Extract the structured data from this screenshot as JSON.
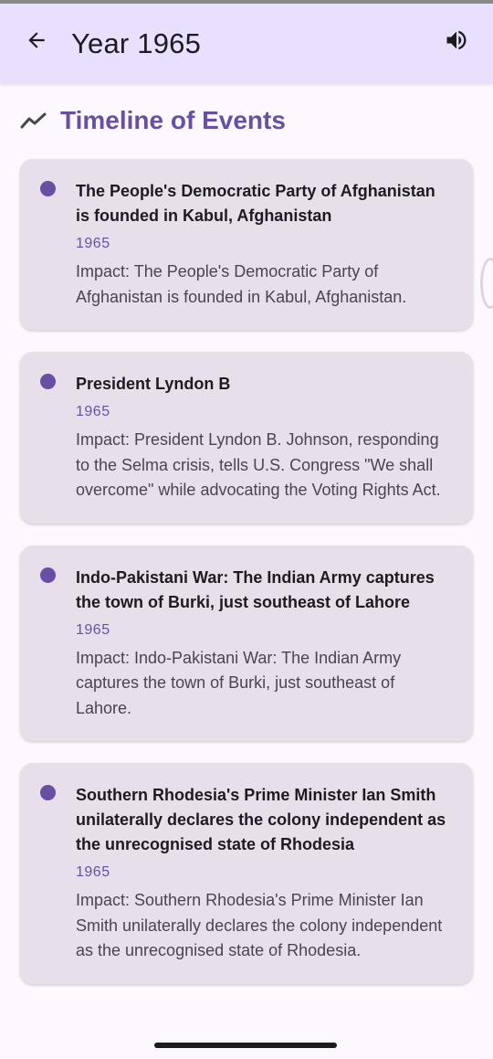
{
  "appbar": {
    "title": "Year 1965",
    "back_icon": "arrow-back-icon",
    "sound_icon": "volume-up-icon",
    "background": "#e8e0fd"
  },
  "section": {
    "title": "Timeline of Events",
    "icon": "trending-icon",
    "accent": "#6750a4"
  },
  "events": [
    {
      "title": "The People's Democratic Party of Afghanistan is founded in Kabul, Afghanistan",
      "year": "1965",
      "impact": "Impact: The People's Democratic Party of Afghanistan is founded in Kabul, Afghanistan."
    },
    {
      "title": "President Lyndon B",
      "year": "1965",
      "impact": "Impact: President Lyndon B. Johnson, responding to the Selma crisis, tells U.S. Congress \"We shall overcome\" while advocating the Voting Rights Act."
    },
    {
      "title": "Indo-Pakistani War: The Indian Army captures the town of Burki, just southeast of Lahore",
      "year": "1965",
      "impact": "Impact: Indo-Pakistani War: The Indian Army captures the town of Burki, just southeast of Lahore."
    },
    {
      "title": "Southern Rhodesia's Prime Minister Ian Smith unilaterally declares the colony independent as the unrecognised state of Rhodesia",
      "year": "1965",
      "impact": "Impact: Southern Rhodesia's Prime Minister Ian Smith unilaterally declares the colony independent as the unrecognised state of Rhodesia."
    }
  ]
}
